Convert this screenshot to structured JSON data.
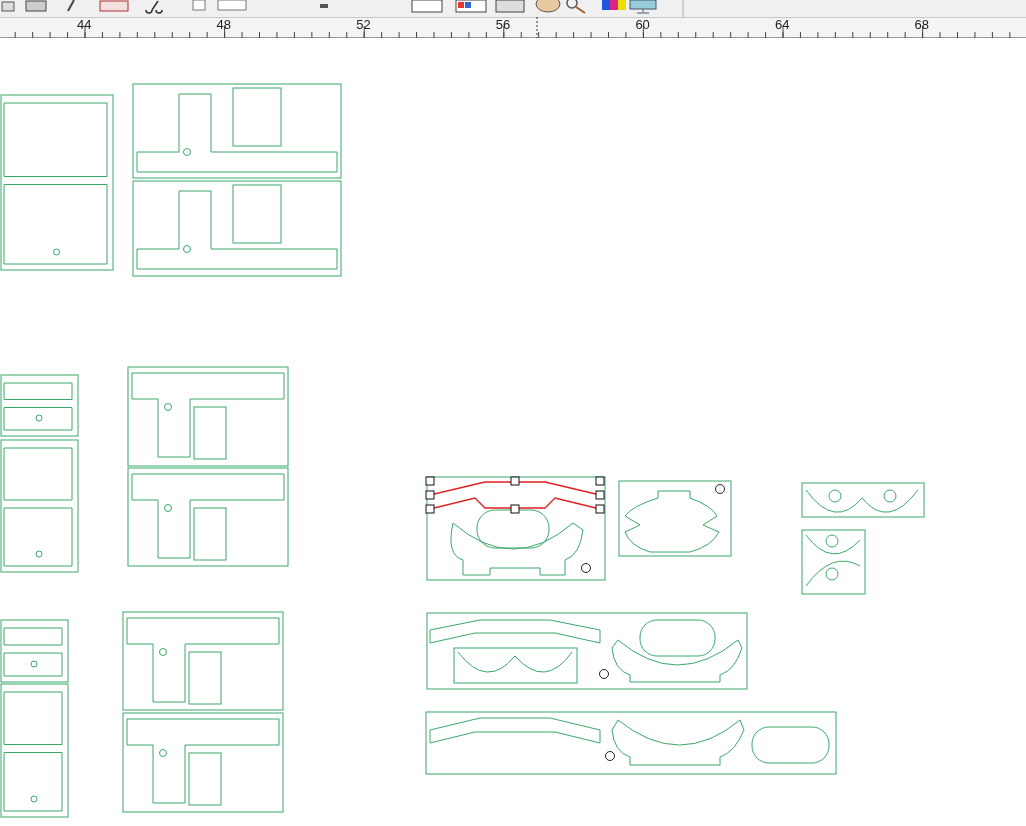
{
  "ruler": {
    "labels": [
      "44",
      "48",
      "52",
      "56",
      "60",
      "64",
      "68"
    ]
  }
}
